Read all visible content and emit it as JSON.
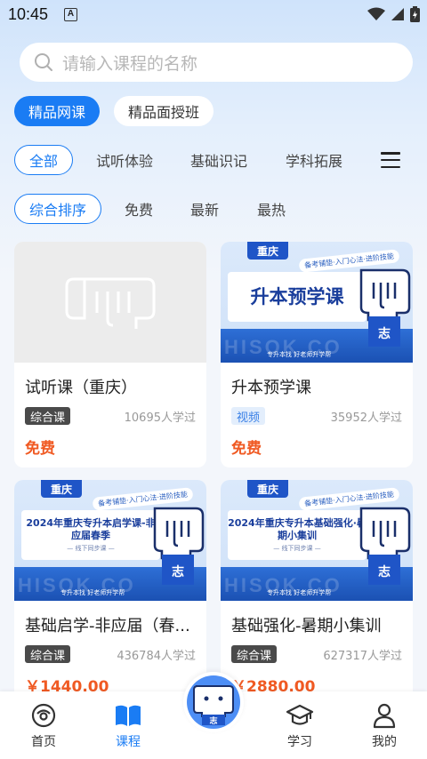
{
  "status_bar": {
    "time": "10:45",
    "notif_letter": "A"
  },
  "search": {
    "placeholder": "请输入课程的名称"
  },
  "top_tabs": [
    {
      "label": "精品网课",
      "active": true
    },
    {
      "label": "精品面授班",
      "active": false
    }
  ],
  "categories": [
    {
      "label": "全部",
      "active": true
    },
    {
      "label": "试听体验",
      "active": false
    },
    {
      "label": "基础识记",
      "active": false
    },
    {
      "label": "学科拓展",
      "active": false
    }
  ],
  "sort_options": [
    {
      "label": "综合排序",
      "active": true
    },
    {
      "label": "免费",
      "active": false
    },
    {
      "label": "最新",
      "active": false
    },
    {
      "label": "最热",
      "active": false
    }
  ],
  "courses": [
    {
      "title": "试听课（重庆）",
      "tag": "综合课",
      "learners": "10695人学过",
      "price": "免费",
      "thumb": "placeholder"
    },
    {
      "title": "升本预学课",
      "tag": "视频",
      "learners": "35952人学过",
      "price": "免费",
      "thumb": "banner",
      "banner": {
        "city": "重庆",
        "slogan": "备考铺垫·入门心法·进阶技能",
        "title": "升本预学课",
        "sub": "",
        "watermark": "HISOK CO",
        "footer": "专升本找 好老师升学帮"
      }
    },
    {
      "title": "基础启学-非应届（春...",
      "tag": "综合课",
      "learners": "436784人学过",
      "price": "￥1440.00",
      "thumb": "banner",
      "banner": {
        "city": "重庆",
        "slogan": "备考铺垫·入门心法·进阶技能",
        "title": "2024年重庆专升本启学课-非应届春季",
        "sub": "— 线下同步课 —",
        "watermark": "HISOK CO",
        "footer": "专升本找 好老师升学帮"
      }
    },
    {
      "title": "基础强化-暑期小集训",
      "tag": "综合课",
      "learners": "627317人学过",
      "price": "￥2880.00",
      "thumb": "banner",
      "banner": {
        "city": "重庆",
        "slogan": "备考铺垫·入门心法·进阶技能",
        "title": "2024年重庆专升本基础强化·暑期小集训",
        "sub": "— 线下同步课 —",
        "watermark": "HISOK CO",
        "footer": "专升本找 好老师升学帮"
      }
    }
  ],
  "bottom_nav": [
    {
      "label": "首页",
      "icon": "home-icon",
      "active": false
    },
    {
      "label": "课程",
      "icon": "book-icon",
      "active": true
    },
    {
      "label": "学习",
      "icon": "graduation-cap-icon",
      "active": false
    },
    {
      "label": "我的",
      "icon": "user-icon",
      "active": false
    }
  ],
  "colors": {
    "accent": "#1a7cf4",
    "price": "#f05a23",
    "banner_blue": "#1f55c7"
  }
}
